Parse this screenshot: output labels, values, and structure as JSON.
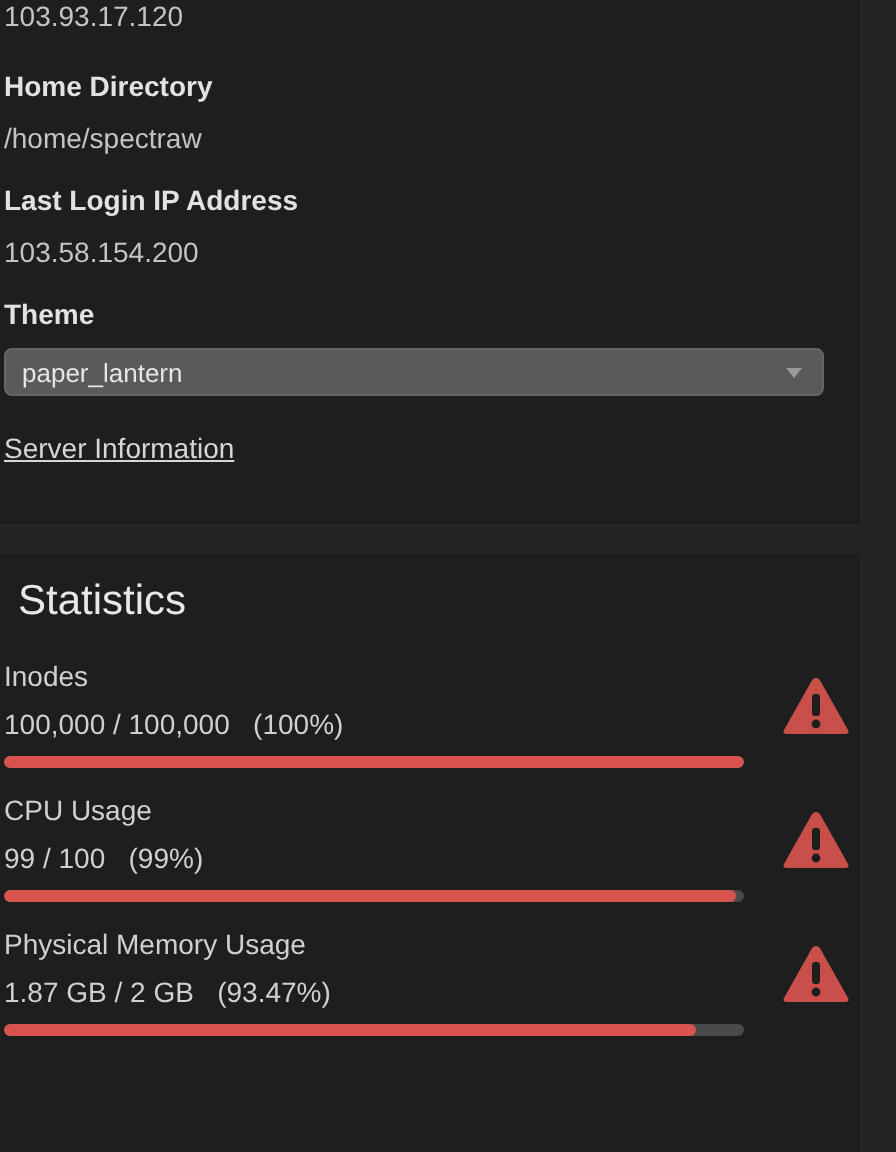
{
  "account_info": {
    "fields": [
      {
        "value": "103.93.17.120"
      },
      {
        "label": "Home Directory",
        "value": "/home/spectraw"
      },
      {
        "label": "Last Login IP Address",
        "value": "103.58.154.200"
      }
    ],
    "theme": {
      "label": "Theme",
      "value": "paper_lantern"
    },
    "link": "Server Information"
  },
  "statistics": {
    "title": "Statistics",
    "items": [
      {
        "label": "Inodes",
        "reading": "100,000 / 100,000   (100%)",
        "level": 1.0,
        "warning": true
      },
      {
        "label": "CPU Usage",
        "reading": "99 / 100   (99%)",
        "level": 0.99,
        "warning": true
      },
      {
        "label": "Physical Memory Usage",
        "reading": "1.87 GB / 2 GB   (93.47%)",
        "level": 0.9347,
        "warning": true
      }
    ]
  }
}
